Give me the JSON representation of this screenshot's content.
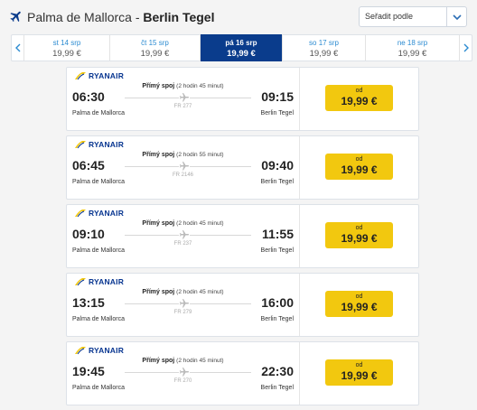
{
  "header": {
    "route_from": "Palma de Mallorca",
    "route_separator": " - ",
    "route_to": "Berlin Tegel"
  },
  "sort": {
    "label": "Seřadit podle"
  },
  "date_bar": {
    "dates": [
      {
        "label": "st 14 srp",
        "price": "19,99 €"
      },
      {
        "label": "čt 15 srp",
        "price": "19,99 €"
      },
      {
        "label": "pá 16 srp",
        "price": "19,99 €"
      },
      {
        "label": "so 17 srp",
        "price": "19,99 €"
      },
      {
        "label": "ne 18 srp",
        "price": "19,99 €"
      }
    ],
    "active_index": 2
  },
  "flights": [
    {
      "airline": "RYANAIR",
      "direct_label": "Přímý spoj",
      "duration": "(2 hodin 45 minut)",
      "flight_no": "FR 277",
      "dep_time": "06:30",
      "arr_time": "09:15",
      "dep_city": "Palma de Mallorca",
      "arr_city": "Berlin Tegel",
      "price_from": "od",
      "price": "19,99 €"
    },
    {
      "airline": "RYANAIR",
      "direct_label": "Přímý spoj",
      "duration": "(2 hodin 55 minut)",
      "flight_no": "FR 2146",
      "dep_time": "06:45",
      "arr_time": "09:40",
      "dep_city": "Palma de Mallorca",
      "arr_city": "Berlin Tegel",
      "price_from": "od",
      "price": "19,99 €"
    },
    {
      "airline": "RYANAIR",
      "direct_label": "Přímý spoj",
      "duration": "(2 hodin 45 minut)",
      "flight_no": "FR 237",
      "dep_time": "09:10",
      "arr_time": "11:55",
      "dep_city": "Palma de Mallorca",
      "arr_city": "Berlin Tegel",
      "price_from": "od",
      "price": "19,99 €"
    },
    {
      "airline": "RYANAIR",
      "direct_label": "Přímý spoj",
      "duration": "(2 hodin 45 minut)",
      "flight_no": "FR 279",
      "dep_time": "13:15",
      "arr_time": "16:00",
      "dep_city": "Palma de Mallorca",
      "arr_city": "Berlin Tegel",
      "price_from": "od",
      "price": "19,99 €"
    },
    {
      "airline": "RYANAIR",
      "direct_label": "Přímý spoj",
      "duration": "(2 hodin 45 minut)",
      "flight_no": "FR 270",
      "dep_time": "19:45",
      "arr_time": "22:30",
      "dep_city": "Palma de Mallorca",
      "arr_city": "Berlin Tegel",
      "price_from": "od",
      "price": "19,99 €"
    }
  ],
  "colors": {
    "brand_navy": "#0a3c8c",
    "price_yellow": "#f2c80f",
    "date_link_blue": "#2b8bd1",
    "ryanair_blue": "#073590"
  },
  "icons": {
    "header": "plane-icon",
    "sort": "chevron-down-icon",
    "date_prev": "chevron-left-icon",
    "date_next": "chevron-right-icon",
    "route": "plane-icon",
    "airline": "ryanair-harp-logo"
  }
}
